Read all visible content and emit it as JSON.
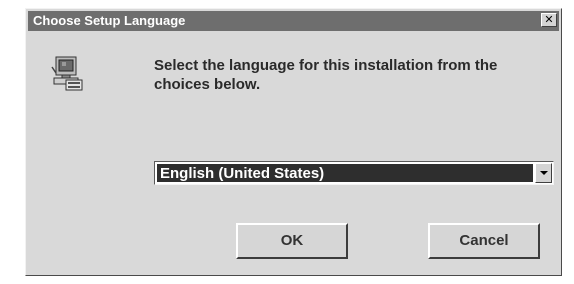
{
  "window": {
    "title": "Choose Setup Language",
    "close_glyph": "✕"
  },
  "icon": {
    "name": "setup-computer-icon"
  },
  "message": "Select the language for this installation from the choices below.",
  "language_select": {
    "selected": "English (United States)"
  },
  "buttons": {
    "ok": "OK",
    "cancel": "Cancel"
  },
  "colors": {
    "titlebar": "#6e6e6e",
    "dialog_bg": "#d9d9d9",
    "selection_bg": "#2e2e2e"
  }
}
